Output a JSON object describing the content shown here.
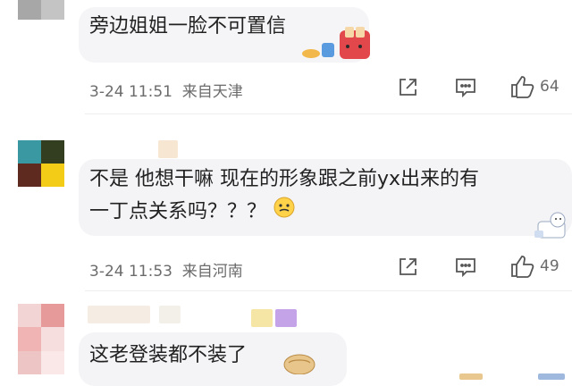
{
  "comments": [
    {
      "text_lines": [
        "旁边姐姐一脸不可置信"
      ],
      "date": "3-24 11:51",
      "location": "来自天津",
      "likes": "64",
      "emoji_icon": "toaster-breakfast-sticker"
    },
    {
      "text_lines": [
        "不是 他想干嘛 现在的形象跟之前yx出来的有",
        "一丁点关系吗？？？"
      ],
      "date": "3-24 11:53",
      "location": "来自河南",
      "likes": "49",
      "emoji_icon": "confused-face-emoji"
    },
    {
      "text_lines": [
        "这老登装都不装了"
      ],
      "emoji_icon": "bread-sticker"
    }
  ],
  "icons": {
    "share": "share-icon",
    "reply": "comment-icon",
    "like": "thumbs-up-icon"
  },
  "colors": {
    "bubble": "#f4f4f7",
    "meta_text": "#6b6b6b",
    "icon": "#555555"
  }
}
